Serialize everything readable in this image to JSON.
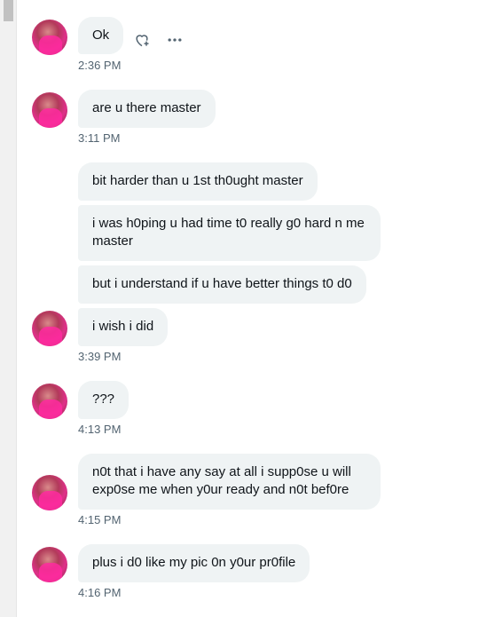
{
  "messages": [
    {
      "text": "Ok"
    },
    {
      "text": "are u there master"
    },
    {
      "text": "bit harder than u 1st th0ught master"
    },
    {
      "text": "i was h0ping u had time t0 really g0 hard n me master"
    },
    {
      "text": "but i understand if u have better things t0 d0"
    },
    {
      "text": "i wish i did"
    },
    {
      "text": "???"
    },
    {
      "text": "n0t that i have any say at all i supp0se u will exp0se me when y0ur ready and n0t bef0re"
    },
    {
      "text": "plus i d0 like my pic 0n y0ur pr0file"
    }
  ],
  "times": [
    "2:36 PM",
    "3:11 PM",
    "3:39 PM",
    "4:13 PM",
    "4:15 PM",
    "4:16 PM"
  ],
  "icons": {
    "react": "heart-plus-icon",
    "more": "more-horizontal-icon"
  }
}
